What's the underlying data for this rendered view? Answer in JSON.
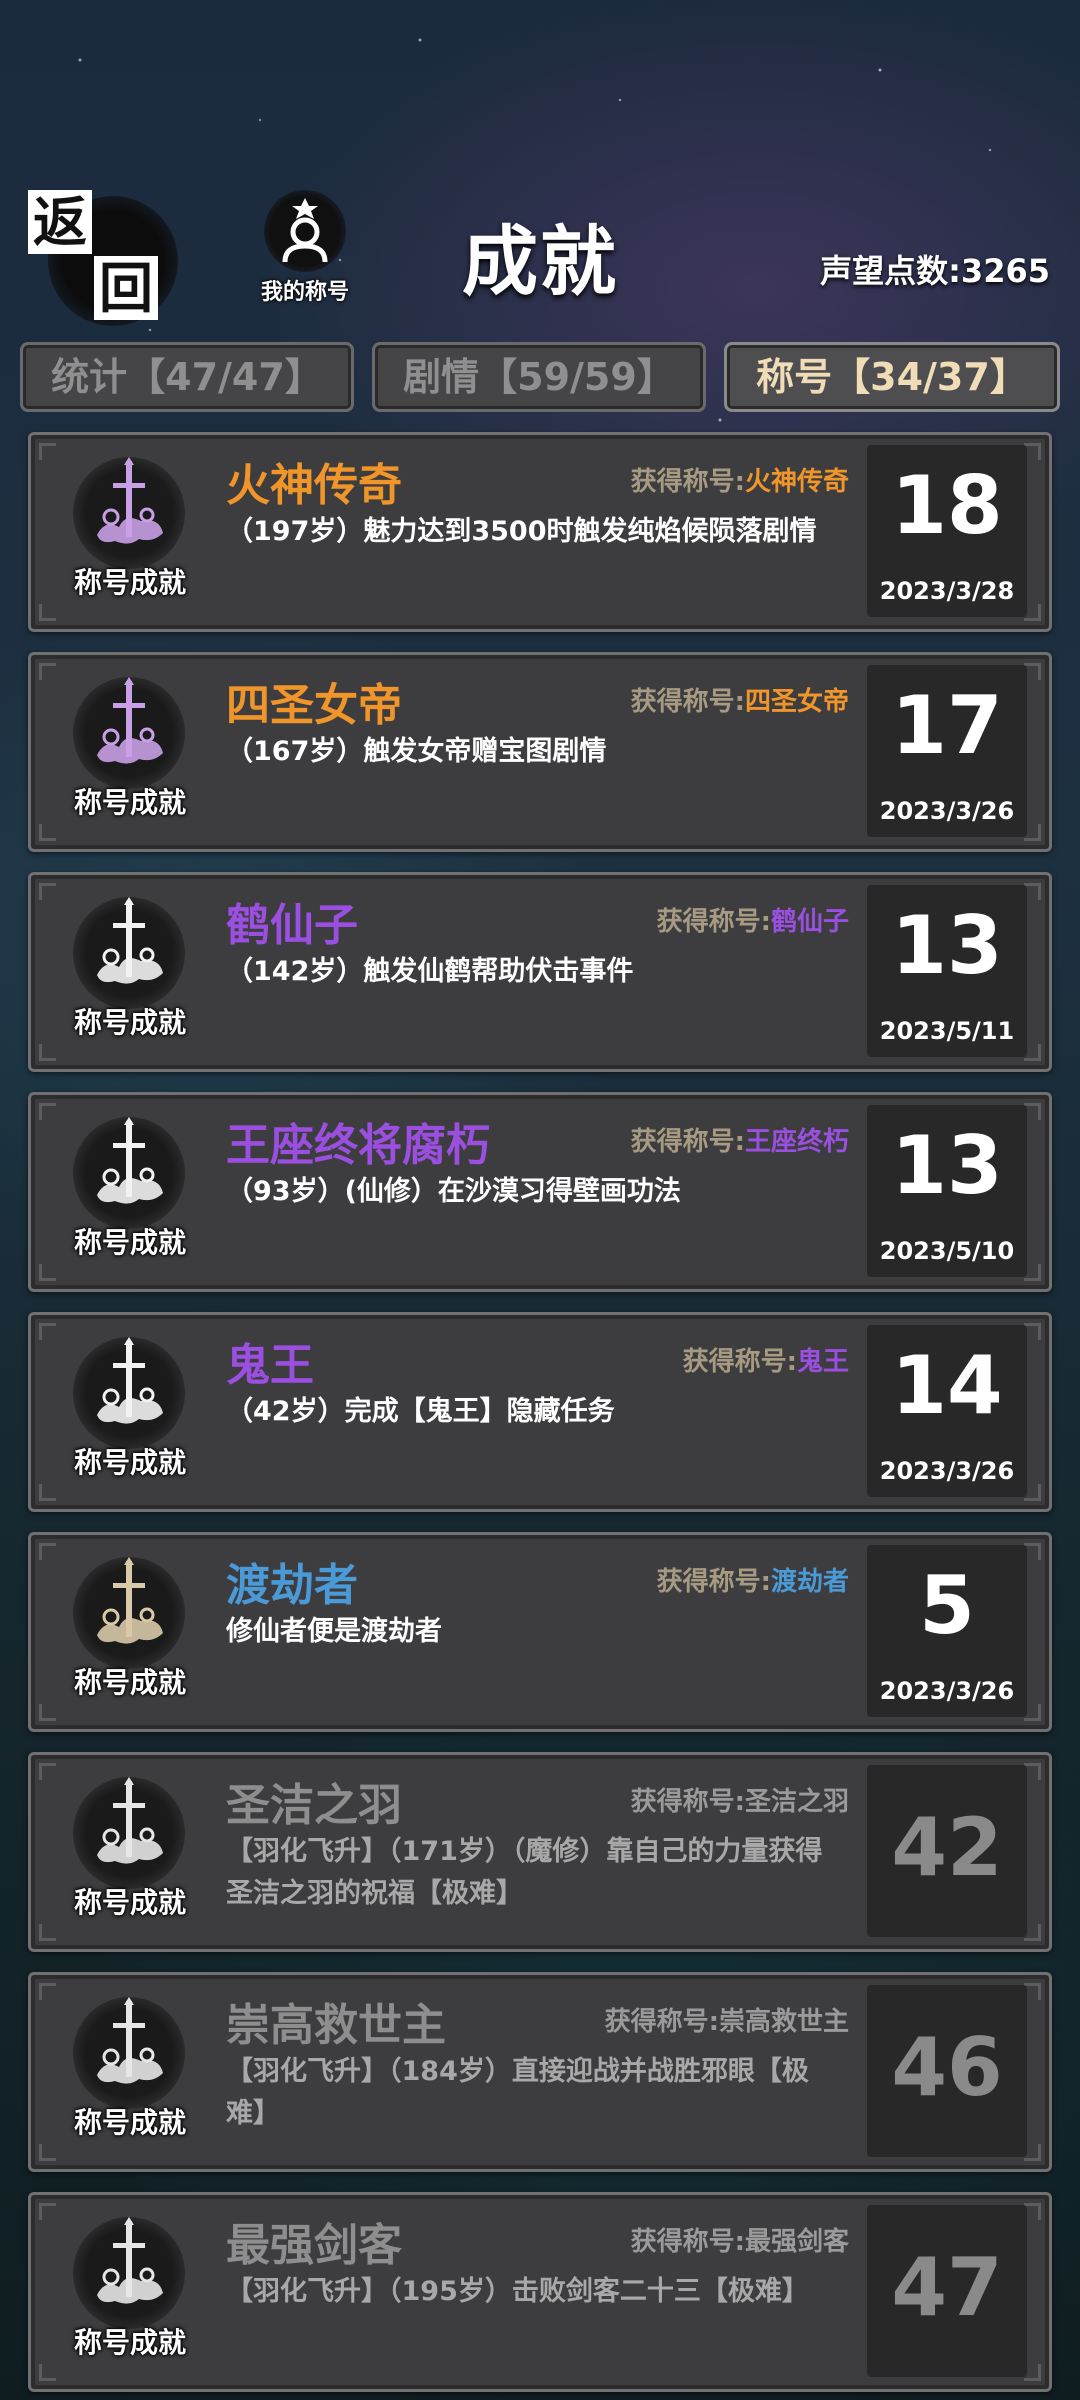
{
  "header": {
    "back_char_1": "返",
    "back_char_2": "回",
    "my_title_label": "我的称号",
    "page_title": "成就",
    "reputation": "声望点数:3265"
  },
  "tabs": [
    {
      "label": "统计【47/47】",
      "active": false
    },
    {
      "label": "剧情【59/59】",
      "active": false
    },
    {
      "label": "称号【34/37】",
      "active": true
    }
  ],
  "emblem_label": "称号成就",
  "reward_prefix": "获得称号:",
  "colors": {
    "orange": "#f0952a",
    "purple": "#9b4fe0",
    "blue": "#4a9ad8",
    "locked": "#8e8e8e"
  },
  "achievements": [
    {
      "name": "火神传奇",
      "reward": "火神传奇",
      "desc": "（197岁）魅力达到3500时触发纯焰候陨落剧情",
      "points": "18",
      "date": "2023/3/28",
      "color": "#f0952a",
      "locked": false,
      "emblem": "pink"
    },
    {
      "name": "四圣女帝",
      "reward": "四圣女帝",
      "desc": "（167岁）触发女帝赠宝图剧情",
      "points": "17",
      "date": "2023/3/26",
      "color": "#f0952a",
      "locked": false,
      "emblem": "pink"
    },
    {
      "name": "鹤仙子",
      "reward": "鹤仙子",
      "desc": "（142岁）触发仙鹤帮助伏击事件",
      "points": "13",
      "date": "2023/5/11",
      "color": "#9b4fe0",
      "locked": false,
      "emblem": "white"
    },
    {
      "name": "王座终将腐朽",
      "reward": "王座终朽",
      "desc": "（93岁）(仙修）在沙漠习得壁画功法",
      "points": "13",
      "date": "2023/5/10",
      "color": "#9b4fe0",
      "locked": false,
      "emblem": "white"
    },
    {
      "name": "鬼王",
      "reward": "鬼王",
      "desc": "（42岁）完成【鬼王】隐藏任务",
      "points": "14",
      "date": "2023/3/26",
      "color": "#9b4fe0",
      "locked": false,
      "emblem": "white"
    },
    {
      "name": "渡劫者",
      "reward": "渡劫者",
      "desc": "修仙者便是渡劫者",
      "points": "5",
      "date": "2023/3/26",
      "color": "#4a9ad8",
      "locked": false,
      "emblem": "gold"
    },
    {
      "name": "圣洁之羽",
      "reward": "圣洁之羽",
      "desc": "【羽化飞升】（171岁）（魔修）靠自己的力量获得圣洁之羽的祝福【极难】",
      "points": "42",
      "date": "",
      "color": "#8e8e8e",
      "locked": true,
      "emblem": "silver"
    },
    {
      "name": "崇高救世主",
      "reward": "崇高救世主",
      "desc": "【羽化飞升】（184岁）直接迎战并战胜邪眼【极难】",
      "points": "46",
      "date": "",
      "color": "#8e8e8e",
      "locked": true,
      "emblem": "silver"
    },
    {
      "name": "最强剑客",
      "reward": "最强剑客",
      "desc": "【羽化飞升】（195岁）击败剑客二十三【极难】",
      "points": "47",
      "date": "",
      "color": "#8e8e8e",
      "locked": true,
      "emblem": "silver"
    }
  ]
}
